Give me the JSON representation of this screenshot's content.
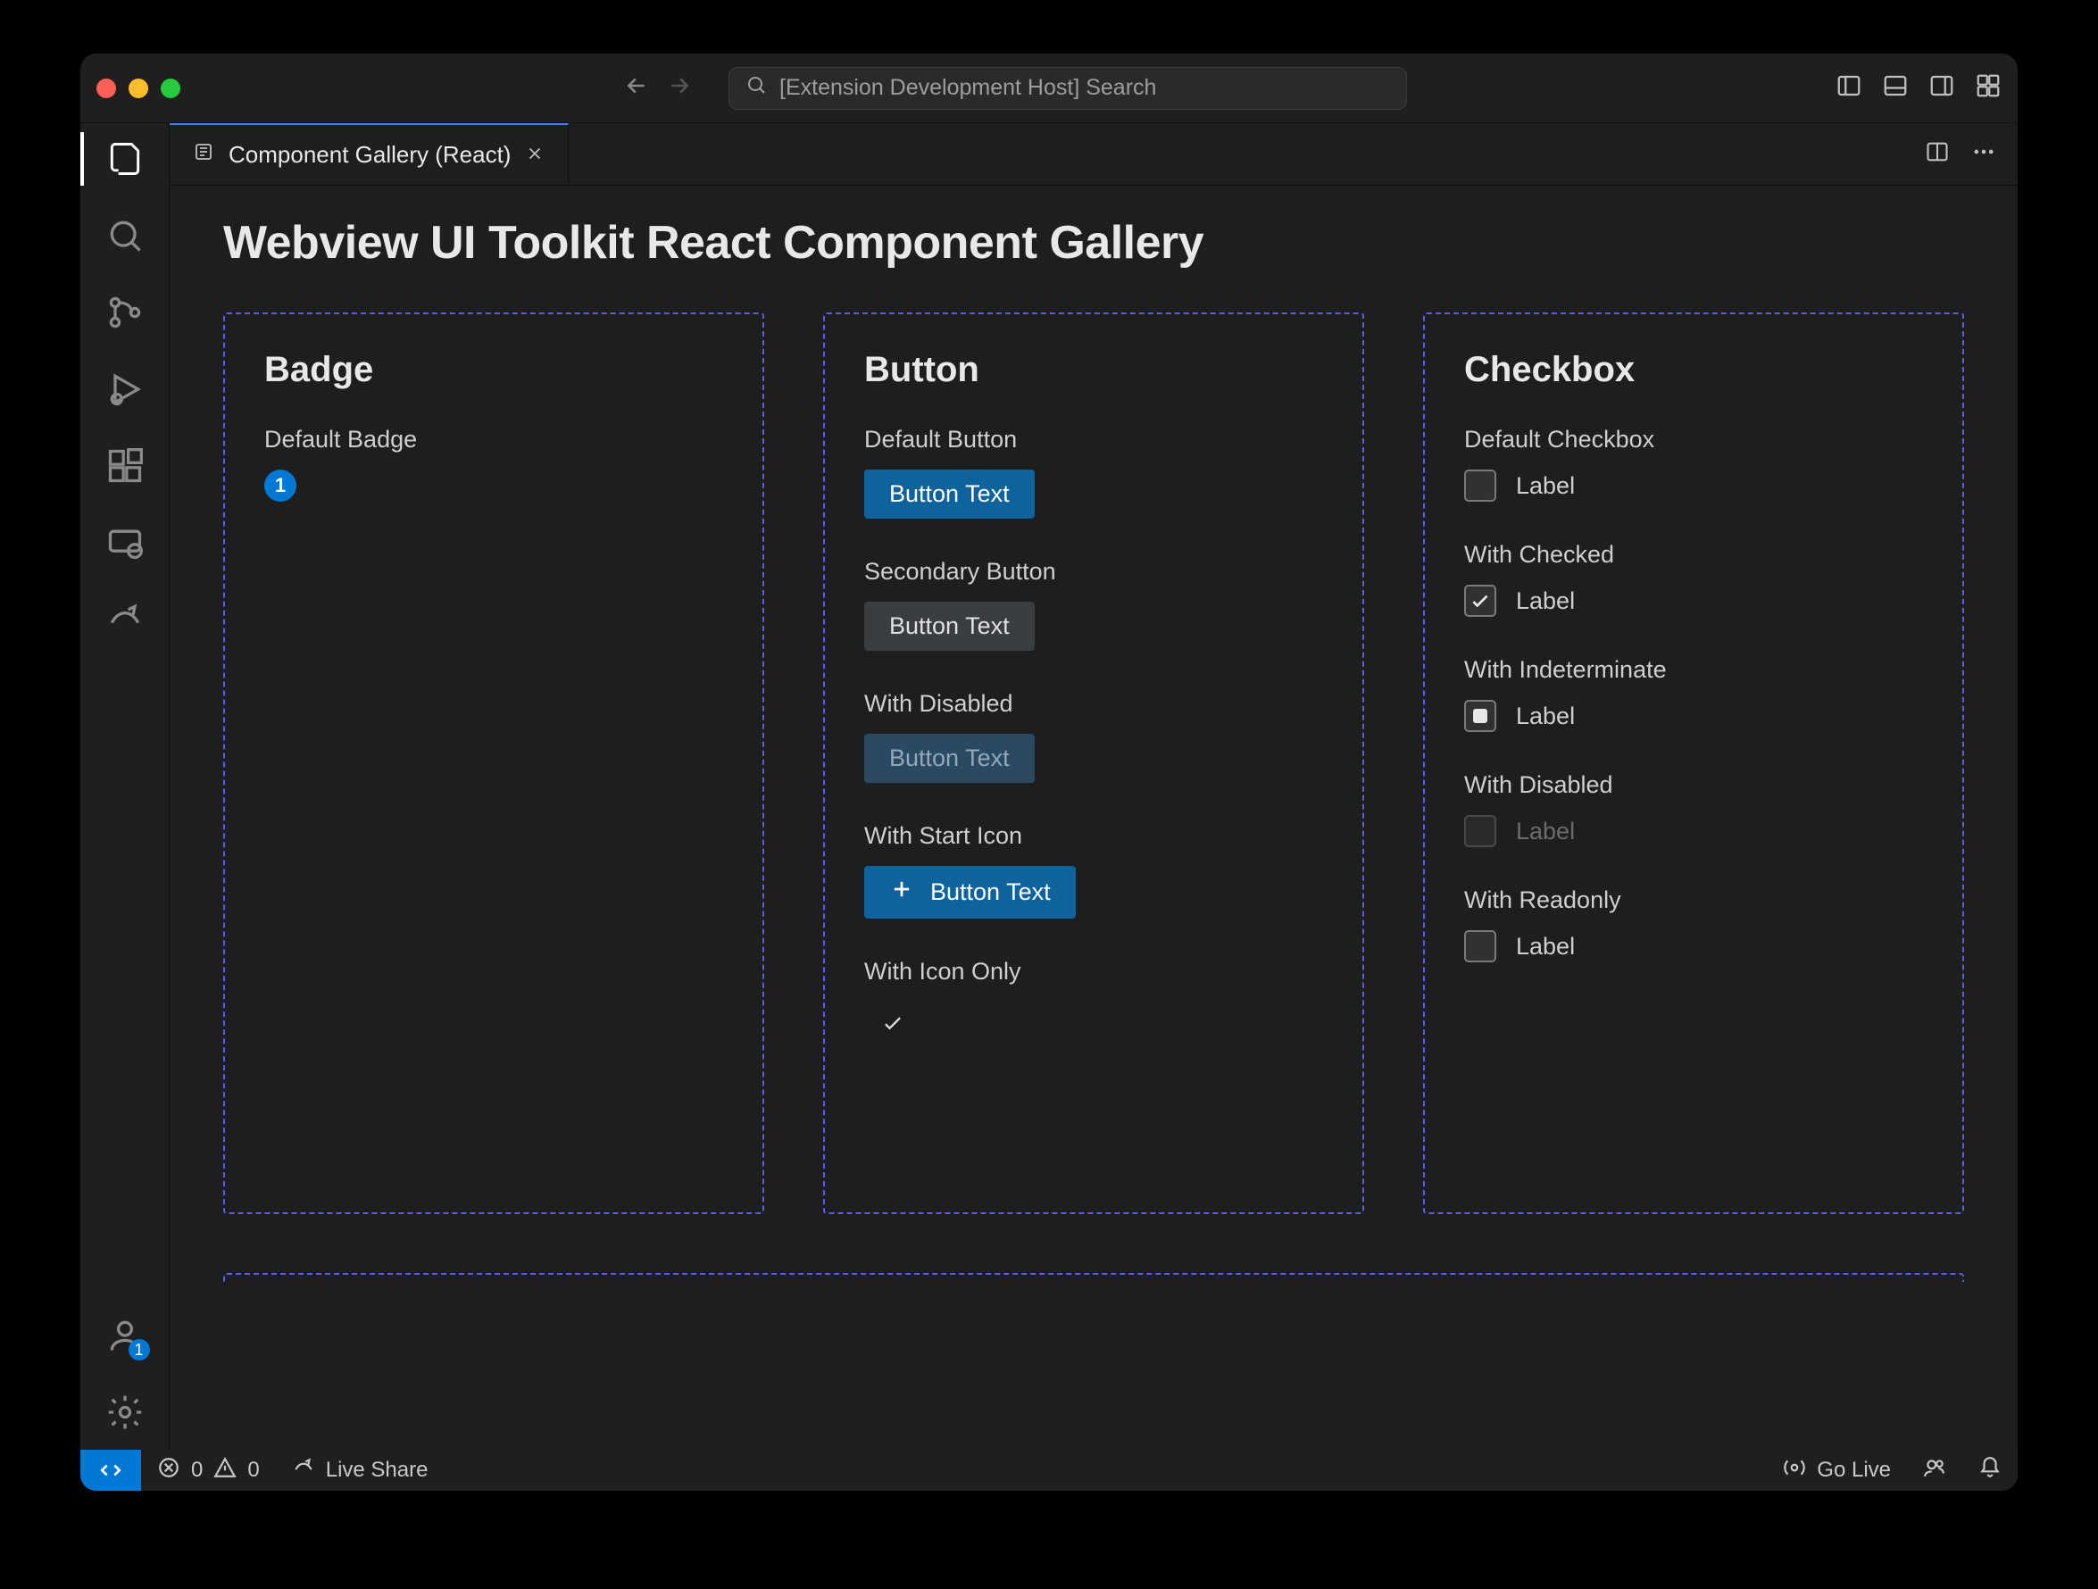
{
  "titlebar": {
    "search_text": "[Extension Development Host] Search"
  },
  "tab": {
    "label": "Component Gallery (React)"
  },
  "page": {
    "title": "Webview UI Toolkit React Component Gallery"
  },
  "activitybar": {
    "account_badge": "1"
  },
  "cards": {
    "badge": {
      "title": "Badge",
      "default_label": "Default Badge",
      "default_value": "1"
    },
    "button": {
      "title": "Button",
      "default_label": "Default Button",
      "default_text": "Button Text",
      "secondary_label": "Secondary Button",
      "secondary_text": "Button Text",
      "disabled_label": "With Disabled",
      "disabled_text": "Button Text",
      "starticon_label": "With Start Icon",
      "starticon_text": "Button Text",
      "icononly_label": "With Icon Only"
    },
    "checkbox": {
      "title": "Checkbox",
      "default_label": "Default Checkbox",
      "default_text": "Label",
      "checked_label": "With Checked",
      "checked_text": "Label",
      "indet_label": "With Indeterminate",
      "indet_text": "Label",
      "disabled_label": "With Disabled",
      "disabled_text": "Label",
      "readonly_label": "With Readonly",
      "readonly_text": "Label"
    }
  },
  "statusbar": {
    "errors": "0",
    "warnings": "0",
    "live_share": "Live Share",
    "go_live": "Go Live"
  }
}
